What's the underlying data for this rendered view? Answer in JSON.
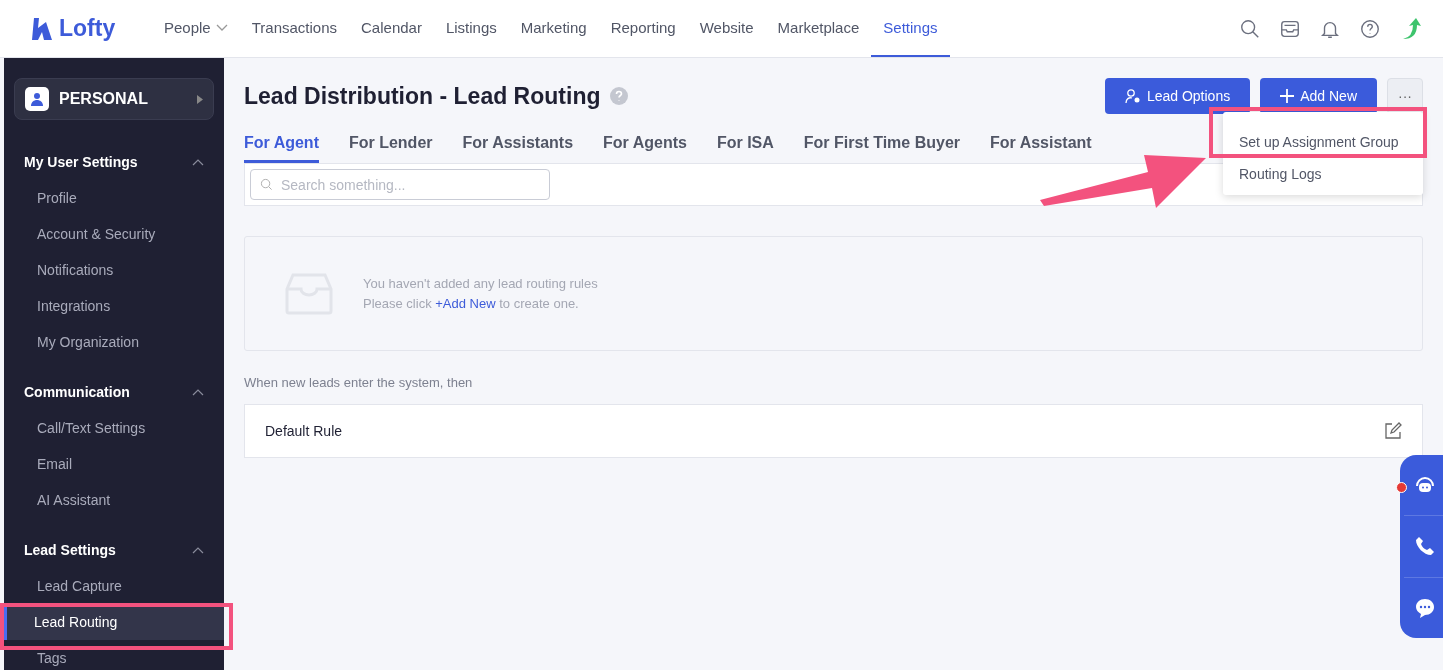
{
  "brand": {
    "name": "Lofty"
  },
  "nav": [
    {
      "label": "People",
      "dropdown": true,
      "selected": false
    },
    {
      "label": "Transactions",
      "dropdown": false,
      "selected": false
    },
    {
      "label": "Calendar",
      "dropdown": false,
      "selected": false
    },
    {
      "label": "Listings",
      "dropdown": false,
      "selected": false
    },
    {
      "label": "Marketing",
      "dropdown": false,
      "selected": false
    },
    {
      "label": "Reporting",
      "dropdown": false,
      "selected": false
    },
    {
      "label": "Website",
      "dropdown": false,
      "selected": false
    },
    {
      "label": "Marketplace",
      "dropdown": false,
      "selected": false
    },
    {
      "label": "Settings",
      "dropdown": false,
      "selected": true
    }
  ],
  "sidebar": {
    "account": "PERSONAL",
    "groups": [
      {
        "title": "My User Settings",
        "expanded": true,
        "items": [
          {
            "label": "Profile",
            "selected": false
          },
          {
            "label": "Account & Security",
            "selected": false
          },
          {
            "label": "Notifications",
            "selected": false
          },
          {
            "label": "Integrations",
            "selected": false
          },
          {
            "label": "My Organization",
            "selected": false
          }
        ]
      },
      {
        "title": "Communication",
        "expanded": true,
        "items": [
          {
            "label": "Call/Text Settings",
            "selected": false
          },
          {
            "label": "Email",
            "selected": false
          },
          {
            "label": "AI Assistant",
            "selected": false
          }
        ]
      },
      {
        "title": "Lead Settings",
        "expanded": true,
        "items": [
          {
            "label": "Lead Capture",
            "selected": false
          },
          {
            "label": "Lead Routing",
            "selected": true
          },
          {
            "label": "Tags",
            "selected": false
          }
        ]
      }
    ]
  },
  "page": {
    "title": "Lead Distribution - Lead Routing",
    "buttons": [
      {
        "label": "Lead Options",
        "kind": "person"
      },
      {
        "label": "Add New",
        "kind": "plus"
      }
    ],
    "more": "···",
    "menu": [
      {
        "label": "Set up Assignment Group",
        "highlighted": true
      },
      {
        "label": "Routing Logs",
        "highlighted": false
      }
    ],
    "tabs": [
      {
        "label": "For Agent",
        "selected": true
      },
      {
        "label": "For Lender",
        "selected": false
      },
      {
        "label": "For Assistants",
        "selected": false
      },
      {
        "label": "For Agents",
        "selected": false
      },
      {
        "label": "For ISA",
        "selected": false
      },
      {
        "label": "For First Time Buyer",
        "selected": false
      },
      {
        "label": "For Assistant",
        "selected": false
      }
    ],
    "search": {
      "placeholder": "Search something..."
    },
    "empty": {
      "line1": "You haven't added any lead routing rules",
      "line2_before": "Please click",
      "link": "+Add New",
      "line2_after": "to create one."
    },
    "note": "When new leads enter the system, then",
    "rules": [
      {
        "name": "Default Rule"
      }
    ]
  },
  "chat_widget": {
    "unread": true
  }
}
